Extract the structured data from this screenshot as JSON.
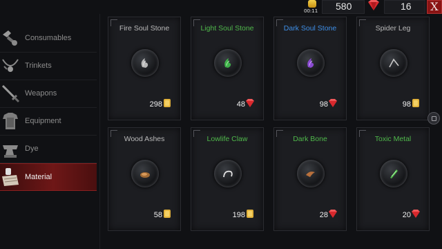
{
  "topbar": {
    "timer": "00:11",
    "gold": "580",
    "gems": "16",
    "close_label": "X"
  },
  "sidebar": {
    "items": [
      {
        "label": "Consumables",
        "icon": "potion-icon",
        "active": false
      },
      {
        "label": "Trinkets",
        "icon": "necklace-icon",
        "active": false
      },
      {
        "label": "Weapons",
        "icon": "sword-icon",
        "active": false
      },
      {
        "label": "Equipment",
        "icon": "armor-icon",
        "active": false
      },
      {
        "label": "Dye",
        "icon": "anvil-icon",
        "active": false
      },
      {
        "label": "Material",
        "icon": "scroll-icon",
        "active": true
      }
    ]
  },
  "items": [
    {
      "name": "Fire Soul Stone",
      "rarity_color": "#b9b9b9",
      "price": "298",
      "currency": "gold",
      "icon": "fire-soul-stone-icon"
    },
    {
      "name": "Light Soul Stone",
      "rarity_color": "#4fb84a",
      "price": "48",
      "currency": "gem",
      "icon": "light-soul-stone-icon"
    },
    {
      "name": "Dark Soul Stone",
      "rarity_color": "#3d8ee6",
      "price": "98",
      "currency": "gem",
      "icon": "dark-soul-stone-icon"
    },
    {
      "name": "Spider Leg",
      "rarity_color": "#b9b9b9",
      "price": "98",
      "currency": "gold",
      "icon": "spider-leg-icon"
    },
    {
      "name": "Wood Ashes",
      "rarity_color": "#b9b9b9",
      "price": "58",
      "currency": "gold",
      "icon": "wood-ashes-icon"
    },
    {
      "name": "Lowlife Claw",
      "rarity_color": "#4fb84a",
      "price": "198",
      "currency": "gold",
      "icon": "lowlife-claw-icon"
    },
    {
      "name": "Dark Bone",
      "rarity_color": "#4fb84a",
      "price": "28",
      "currency": "gem",
      "icon": "dark-bone-icon"
    },
    {
      "name": "Toxic Metal",
      "rarity_color": "#4fb84a",
      "price": "20",
      "currency": "gem",
      "icon": "toxic-metal-icon"
    }
  ],
  "colors": {
    "accent_red": "#8a1414",
    "gold": "#e2b23a",
    "gem": "#d8282d"
  }
}
